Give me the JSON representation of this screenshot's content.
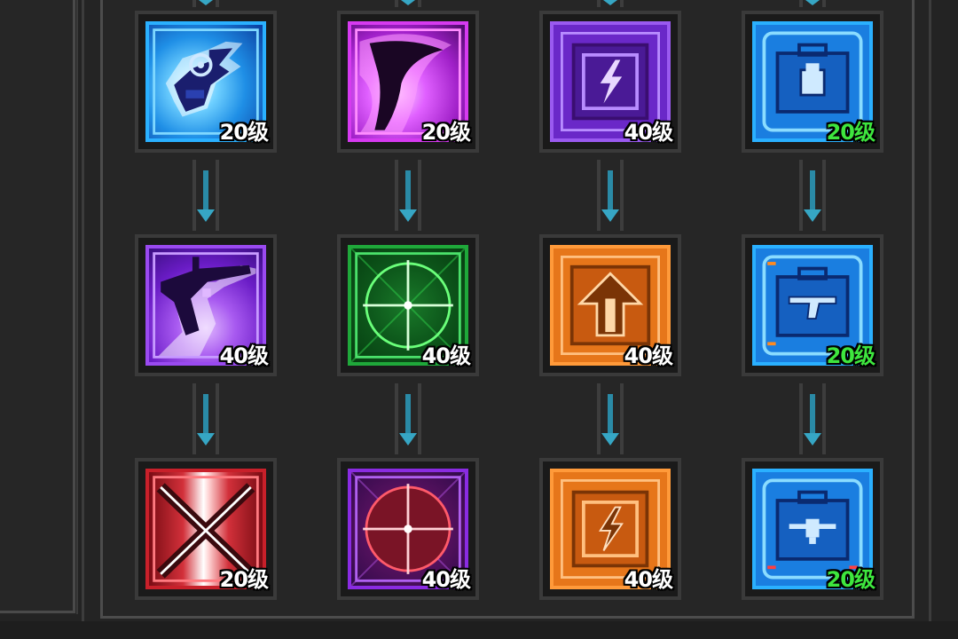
{
  "skill_tree": {
    "columns": [
      {
        "nodes": [
          {
            "name": "blue-tech-gun-skill",
            "icon": "tech-gun-icon",
            "level": "20级",
            "level_color": "#ffffff"
          },
          {
            "name": "purple-sniper-skill",
            "icon": "sniper-rifle-icon",
            "level": "40级",
            "level_color": "#ffffff"
          },
          {
            "name": "red-crossed-rifles-skill",
            "icon": "crossed-rifles-icon",
            "level": "20级",
            "level_color": "#ffffff"
          }
        ]
      },
      {
        "nodes": [
          {
            "name": "purple-flame-skill",
            "icon": "purple-flame-icon",
            "level": "20级",
            "level_color": "#ffffff"
          },
          {
            "name": "green-crosshair-skill",
            "icon": "crosshair-icon",
            "level": "40级",
            "level_color": "#ffffff"
          },
          {
            "name": "red-crosshair-skill",
            "icon": "crosshair-icon",
            "level": "40级",
            "level_color": "#ffffff"
          }
        ]
      },
      {
        "nodes": [
          {
            "name": "purple-lightning-box-skill",
            "icon": "lightning-box-icon",
            "level": "40级",
            "level_color": "#ffffff"
          },
          {
            "name": "orange-upgrade-arrow-skill",
            "icon": "upgrade-arrow-icon",
            "level": "40级",
            "level_color": "#ffffff"
          },
          {
            "name": "orange-lightning-box-skill",
            "icon": "lightning-box-icon",
            "level": "40级",
            "level_color": "#ffffff"
          }
        ]
      },
      {
        "nodes": [
          {
            "name": "blue-ammo-case-skill",
            "icon": "ammo-case-icon",
            "level": "20级",
            "level_color": "#3ee63e"
          },
          {
            "name": "blue-pistol-case-skill",
            "icon": "pistol-case-icon",
            "level": "20级",
            "level_color": "#3ee63e"
          },
          {
            "name": "blue-drone-case-skill",
            "icon": "drone-case-icon",
            "level": "20级",
            "level_color": "#3ee63e"
          }
        ]
      }
    ],
    "colors": {
      "blue": "#1f8fe6",
      "purple": "#8a2be2",
      "magenta": "#c21fd6",
      "orange": "#e6761a",
      "green": "#1fa83a",
      "red": "#c8202a",
      "connector": "#36a6c4"
    }
  }
}
